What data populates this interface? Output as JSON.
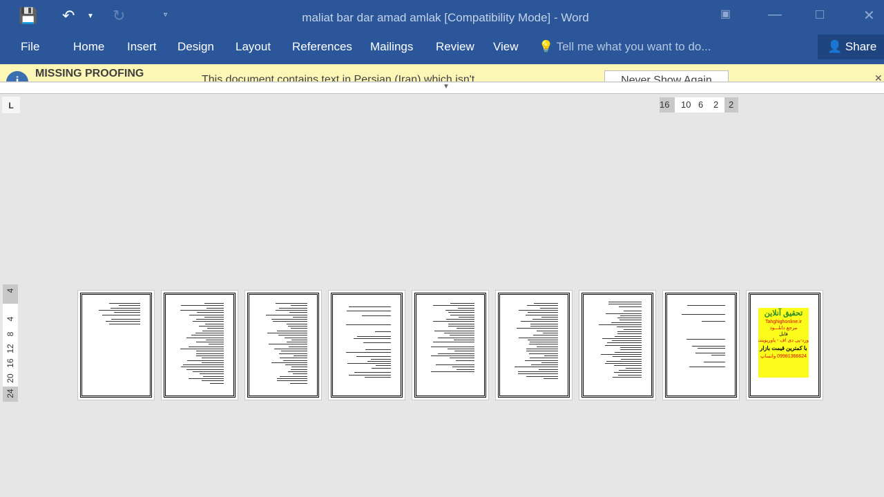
{
  "window": {
    "title": "maliat bar dar amad amlak [Compatibility Mode] - Word"
  },
  "ribbon": {
    "tabs": [
      "File",
      "Home",
      "Insert",
      "Design",
      "Layout",
      "References",
      "Mailings",
      "Review",
      "View"
    ],
    "tell_me": "Tell me what you want to do...",
    "share": "Share"
  },
  "message_bar": {
    "title": "MISSING PROOFING",
    "text": "This document contains text in Persian (Iran) which isn't",
    "button": "Never Show Again"
  },
  "ruler": {
    "horizontal": [
      "16",
      "10",
      "6",
      "2",
      "2"
    ],
    "vertical": [
      "4",
      "4",
      "8",
      "12",
      "16",
      "20",
      "24"
    ]
  },
  "pages": {
    "count": 9,
    "ad": {
      "title": "تحقیق آنلاین",
      "site": "Tahghighonline.ir",
      "l1": "مرجع دانلـــود",
      "l2": "فایل",
      "l3": "ورد-پی دی اف - پاورپوینت",
      "l4": "با کمترین قیمت بازار",
      "l5": "09981366624 واتساپ"
    }
  },
  "colors": {
    "ribbon": "#2b579a",
    "message_bar": "#fcf7b6",
    "canvas": "#e6e6e6"
  }
}
